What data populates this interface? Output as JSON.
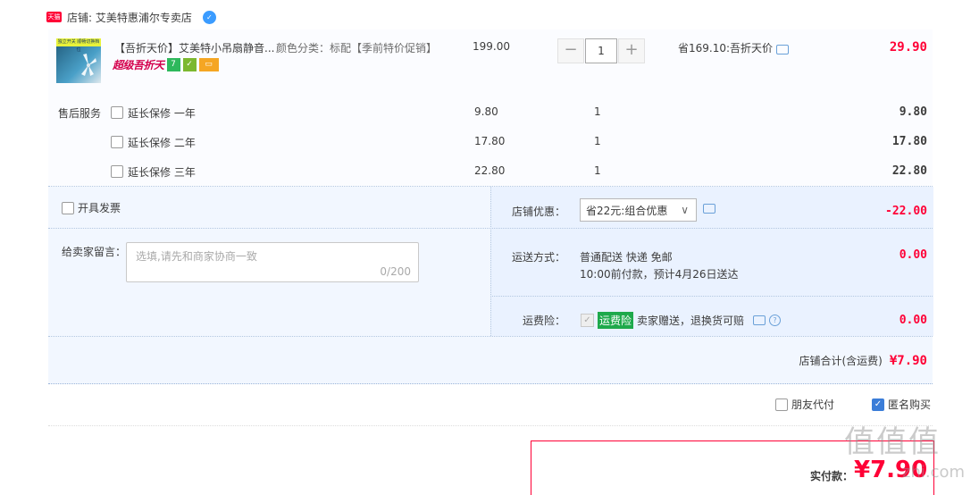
{
  "shop": {
    "tmall_logo_text": "天猫",
    "name": "店铺: 艾美特惠浦尔专卖店",
    "chat_icon": "wangwang-chat-icon"
  },
  "item": {
    "thumb_text": "独立开关 顺畅切换档位",
    "title": "【吾折天价】艾美特小吊扇静音...",
    "sku": "颜色分类：标配【季前特价促销】",
    "badge_super": "超级吾折天",
    "badge_7": "7",
    "price": "199.00",
    "qty": "1",
    "qty_minus": "−",
    "qty_plus": "+",
    "discount": "省169.10:吾折天价",
    "total": "29.90"
  },
  "service": {
    "label": "售后服务",
    "rows": [
      {
        "name": "延长保修 一年",
        "price": "9.80",
        "qty": "1",
        "total": "9.80"
      },
      {
        "name": "延长保修 二年",
        "price": "17.80",
        "qty": "1",
        "total": "17.80"
      },
      {
        "name": "延长保修 三年",
        "price": "22.80",
        "qty": "1",
        "total": "22.80"
      }
    ]
  },
  "invoice_label": "开具发票",
  "message": {
    "label": "给卖家留言：",
    "placeholder": "选填,请先和商家协商一致",
    "count": "0/200"
  },
  "shop_coupon": {
    "label": "店铺优惠：",
    "selected": "省22元:组合优惠",
    "value": "-22.00"
  },
  "shipping": {
    "label": "运送方式：",
    "line1": "普通配送 快递 免邮",
    "line2": "10:00前付款，预计4月26日送达",
    "value": "0.00"
  },
  "freight_insurance": {
    "label": "运费险：",
    "tag": "运费险",
    "text": "卖家赠送，退换货可赔",
    "value": "0.00"
  },
  "subtotal": {
    "label": "店铺合计(含运费)",
    "value": "¥7.90"
  },
  "options": {
    "friend_pay": "朋友代付",
    "anonymous": "匿名购买"
  },
  "payment": {
    "label": "实付款：",
    "amount": "¥7.90"
  },
  "watermark": {
    "text": "值值值",
    "url": "zhi.com"
  },
  "colors": {
    "accent_red": "#ff0036",
    "panel_blue": "#f2f7ff",
    "check_blue": "#3b7dd8",
    "insurance_green": "#1ea94b"
  }
}
